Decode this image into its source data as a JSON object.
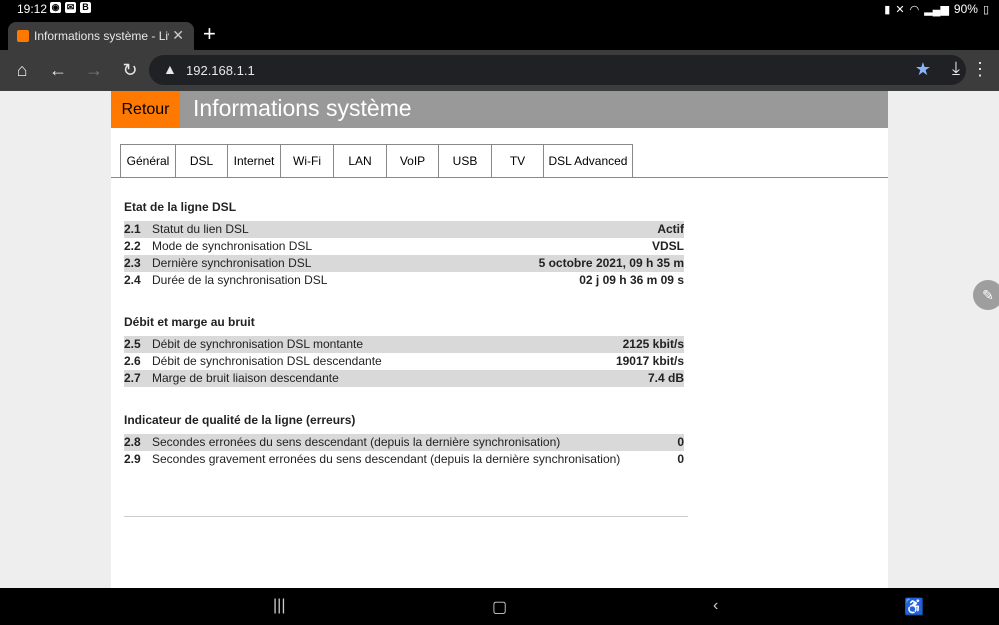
{
  "status_bar": {
    "time": "19:12",
    "battery": "90%",
    "notif_badge": "B"
  },
  "browser": {
    "tab_title": "Informations système - Liveb",
    "url": "192.168.1.1"
  },
  "page": {
    "back_label": "Retour",
    "title": "Informations système",
    "tabs": [
      "Général",
      "DSL",
      "Internet",
      "Wi-Fi",
      "LAN",
      "VoIP",
      "USB",
      "TV",
      "DSL Advanced"
    ],
    "active_tab": "DSL",
    "sections": [
      {
        "title": "Etat de la ligne DSL",
        "rows": [
          {
            "num": "2.1",
            "label": "Statut du lien DSL",
            "value": "Actif"
          },
          {
            "num": "2.2",
            "label": "Mode de synchronisation DSL",
            "value": "VDSL"
          },
          {
            "num": "2.3",
            "label": "Dernière synchronisation DSL",
            "value": "5 octobre 2021, 09 h 35 m"
          },
          {
            "num": "2.4",
            "label": "Durée de la synchronisation DSL",
            "value": "02 j 09 h 36 m 09 s"
          }
        ]
      },
      {
        "title": "Débit et marge au bruit",
        "rows": [
          {
            "num": "2.5",
            "label": "Débit de synchronisation DSL montante",
            "value": "2125 kbit/s"
          },
          {
            "num": "2.6",
            "label": "Débit de synchronisation DSL descendante",
            "value": "19017 kbit/s"
          },
          {
            "num": "2.7",
            "label": "Marge de bruit liaison descendante",
            "value": "7.4 dB"
          }
        ]
      },
      {
        "title": "Indicateur de qualité de la ligne (erreurs)",
        "rows": [
          {
            "num": "2.8",
            "label": "Secondes erronées du sens descendant (depuis la dernière synchronisation)",
            "value": "0"
          },
          {
            "num": "2.9",
            "label": "Secondes gravement erronées du sens descendant (depuis la dernière synchronisation)",
            "value": "0"
          }
        ]
      }
    ]
  },
  "colors": {
    "accent_orange": "#ff7900",
    "header_grey": "#999999",
    "row_shade": "#d9d9d9"
  }
}
